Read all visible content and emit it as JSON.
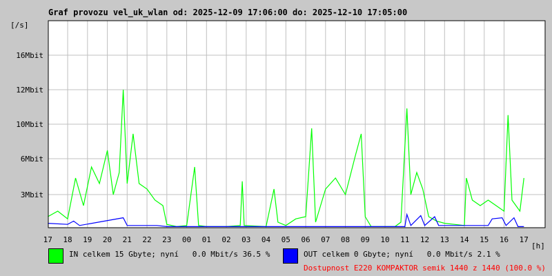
{
  "chart_data": {
    "type": "line",
    "title": "Graf provozu vel_uk_wlan od: 2025-12-09 17:06:00 do: 2025-12-10 17:05:00",
    "ylabel": "[/s]",
    "xlabel": "[h]",
    "x_unit": "hours since 17:00",
    "ylim": [
      0,
      18.75
    ],
    "xlim": [
      0,
      24
    ],
    "grid": true,
    "xticks": [
      "17",
      "18",
      "19",
      "20",
      "21",
      "22",
      "23",
      "00",
      "01",
      "02",
      "03",
      "04",
      "05",
      "06",
      "07",
      "08",
      "09",
      "10",
      "11",
      "12",
      "13",
      "14",
      "15",
      "16",
      "17"
    ],
    "yticks": [
      {
        "value": 3,
        "label": "3Mbit"
      },
      {
        "value": 6.25,
        "label": "6Mbit"
      },
      {
        "value": 9.375,
        "label": "10Mbit"
      },
      {
        "value": 12.5,
        "label": "12Mbit"
      },
      {
        "value": 15.625,
        "label": "16Mbit"
      }
    ],
    "series": [
      {
        "name": "IN",
        "color": "#00ff00",
        "unit": "Mbit/s",
        "points": [
          [
            0,
            1.0
          ],
          [
            0.5,
            1.5
          ],
          [
            1.0,
            0.8
          ],
          [
            1.4,
            4.5
          ],
          [
            1.8,
            2.0
          ],
          [
            2.2,
            5.5
          ],
          [
            2.6,
            4.0
          ],
          [
            3.0,
            7.0
          ],
          [
            3.3,
            3.0
          ],
          [
            3.6,
            5.0
          ],
          [
            3.8,
            12.5
          ],
          [
            4.0,
            4.0
          ],
          [
            4.3,
            8.5
          ],
          [
            4.6,
            4.0
          ],
          [
            5.0,
            3.5
          ],
          [
            5.4,
            2.5
          ],
          [
            5.8,
            2.0
          ],
          [
            6.0,
            0.3
          ],
          [
            6.5,
            0.1
          ],
          [
            7.0,
            0.2
          ],
          [
            7.4,
            5.5
          ],
          [
            7.6,
            0.2
          ],
          [
            8.0,
            0.1
          ],
          [
            9.0,
            0.1
          ],
          [
            9.7,
            0.2
          ],
          [
            9.8,
            4.2
          ],
          [
            9.9,
            0.2
          ],
          [
            11.0,
            0.1
          ],
          [
            11.4,
            3.5
          ],
          [
            11.6,
            0.5
          ],
          [
            12.0,
            0.2
          ],
          [
            12.5,
            0.8
          ],
          [
            13.0,
            1.0
          ],
          [
            13.3,
            9.0
          ],
          [
            13.5,
            0.5
          ],
          [
            14.0,
            3.5
          ],
          [
            14.5,
            4.5
          ],
          [
            15.0,
            3.0
          ],
          [
            15.5,
            6.5
          ],
          [
            15.8,
            8.5
          ],
          [
            16.0,
            1.0
          ],
          [
            16.3,
            0.1
          ],
          [
            17.5,
            0.1
          ],
          [
            17.8,
            0.5
          ],
          [
            18.1,
            10.8
          ],
          [
            18.3,
            3.0
          ],
          [
            18.6,
            5.0
          ],
          [
            18.9,
            3.5
          ],
          [
            19.2,
            1.0
          ],
          [
            19.6,
            0.6
          ],
          [
            20.0,
            0.4
          ],
          [
            20.5,
            0.3
          ],
          [
            21.0,
            0.2
          ],
          [
            21.1,
            4.5
          ],
          [
            21.4,
            2.5
          ],
          [
            21.8,
            2.0
          ],
          [
            22.2,
            2.5
          ],
          [
            22.6,
            2.0
          ],
          [
            23.0,
            1.5
          ],
          [
            23.2,
            10.2
          ],
          [
            23.4,
            2.5
          ],
          [
            23.8,
            1.5
          ],
          [
            24.0,
            4.5
          ]
        ]
      },
      {
        "name": "OUT",
        "color": "#0000ff",
        "unit": "Mbit/s",
        "points": [
          [
            0,
            0.4
          ],
          [
            1,
            0.3
          ],
          [
            1.3,
            0.6
          ],
          [
            1.6,
            0.2
          ],
          [
            3.8,
            0.9
          ],
          [
            4.0,
            0.2
          ],
          [
            5.5,
            0.2
          ],
          [
            6,
            0.1
          ],
          [
            18,
            0.1
          ],
          [
            18.1,
            1.2
          ],
          [
            18.3,
            0.2
          ],
          [
            18.8,
            1.1
          ],
          [
            19,
            0.2
          ],
          [
            19.5,
            1.0
          ],
          [
            19.7,
            0.2
          ],
          [
            22.2,
            0.2
          ],
          [
            22.4,
            0.8
          ],
          [
            22.9,
            0.9
          ],
          [
            23.1,
            0.2
          ],
          [
            23.5,
            0.9
          ],
          [
            23.7,
            0.1
          ],
          [
            24,
            0.1
          ]
        ]
      }
    ],
    "legend": [
      {
        "text": "IN celkem 15 Gbyte; nyní   0.0 Mbit/s 36.5 %",
        "color": "#00ff00"
      },
      {
        "text": "OUT celkem 0 Gbyte; nyní   0.0 Mbit/s 2.1 %",
        "color": "#0000ff"
      }
    ],
    "availability": "Dostupnost E220 KOMPAKTOR semik 1440 z 1440 (100.0 %)",
    "availability_color": "#ff0000"
  }
}
